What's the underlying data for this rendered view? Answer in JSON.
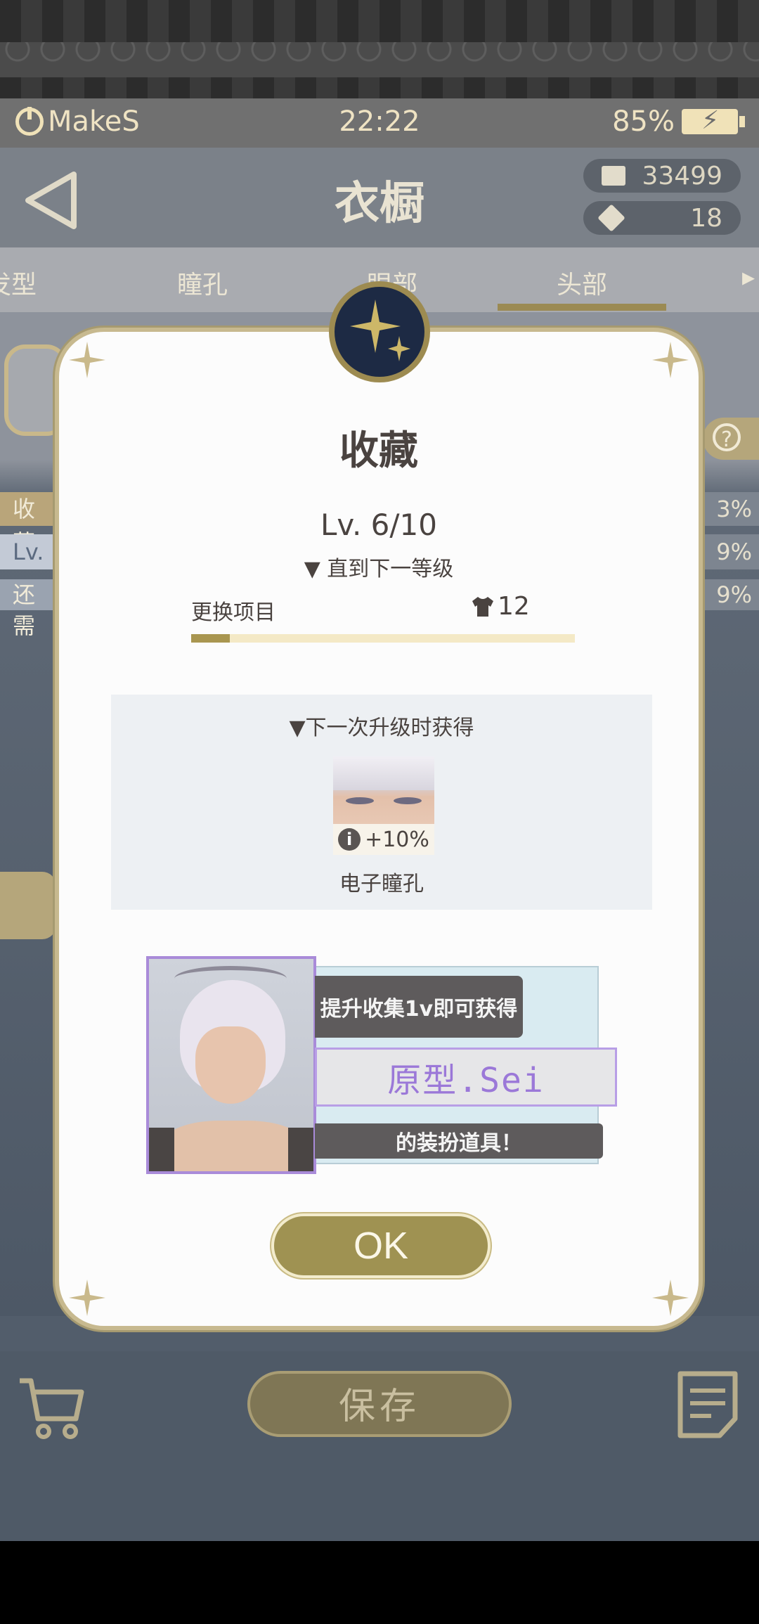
{
  "status_bar": {
    "carrier": "MakeS",
    "time": "22:22",
    "battery": "85%"
  },
  "header": {
    "title": "衣橱",
    "currency_book": "33499",
    "currency_ticket": "18"
  },
  "tabs": [
    {
      "label": "发型"
    },
    {
      "label": "瞳孔"
    },
    {
      "label": "眼部"
    },
    {
      "label": "头部",
      "active": true
    }
  ],
  "background": {
    "left_labels": [
      "收藏",
      "Lv.",
      "还需"
    ],
    "right_values": [
      "3%",
      "9%",
      "9%"
    ]
  },
  "modal": {
    "title": "收藏",
    "level": "Lv. 6/10",
    "next_level_label": "▼ 直到下一等级",
    "change_label": "更换项目",
    "change_count": "12",
    "progress": 0.1,
    "reward_heading": "▼下一次升级时获得",
    "reward_bonus": "+10%",
    "reward_name": "电子瞳孔",
    "promo_line1": "提升收集1v即可获得",
    "promo_name": "原型.Sei",
    "promo_line3": "的装扮道具！",
    "ok_label": "OK"
  },
  "bottom_bar": {
    "save_label": "保存"
  },
  "colors": {
    "gold": "#9f9252",
    "purple": "#9b78d8",
    "navy": "#1d2a44"
  }
}
